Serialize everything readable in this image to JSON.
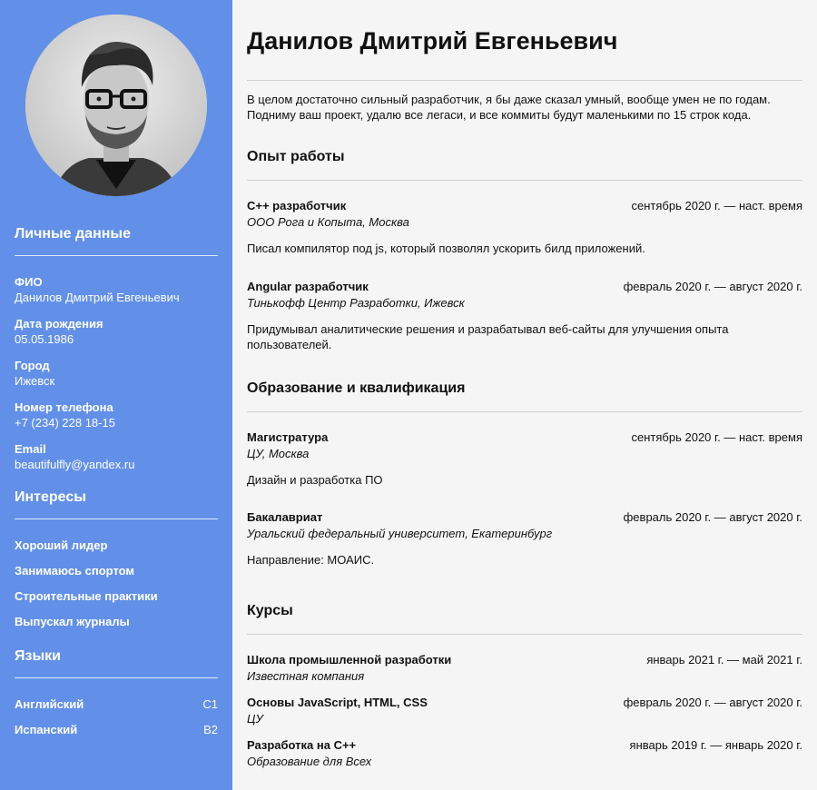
{
  "name": "Данилов Дмитрий Евгеньевич",
  "about": "В целом достаточно сильный разработчик, я бы даже сказал умный, вообще умен не по годам. Подниму ваш проект, удалю все легаси, и все коммиты будут маленькими по 15 строк кода.",
  "colors": {
    "sidebar": "#6290e8",
    "divider": "#d0d0d0"
  },
  "personal": {
    "heading": "Личные данные",
    "items": [
      {
        "label": "ФИО",
        "value": "Данилов Дмитрий Евгеньевич"
      },
      {
        "label": "Дата рождения",
        "value": "05.05.1986"
      },
      {
        "label": "Город",
        "value": "Ижевск"
      },
      {
        "label": "Номер телефона",
        "value": "+7 (234) 228 18-15"
      },
      {
        "label": "Email",
        "value": "beautifulfly@yandex.ru"
      }
    ]
  },
  "interests": {
    "heading": "Интересы",
    "items": [
      "Хороший лидер",
      "Занимаюсь спортом",
      "Строительные практики",
      "Выпускал журналы"
    ]
  },
  "languages": {
    "heading": "Языки",
    "items": [
      {
        "name": "Английский",
        "level": "C1"
      },
      {
        "name": "Испанский",
        "level": "B2"
      }
    ]
  },
  "experience": {
    "heading": "Опыт работы",
    "items": [
      {
        "title": "C++ разработчик",
        "dates": "сентябрь 2020 г. — наст. время",
        "org": "ООО Рога и Копыта, Москва",
        "desc": "Писал компилятор под js, который позволял ускорить билд приложений."
      },
      {
        "title": "Angular разработчик",
        "dates": "февраль 2020 г. — август 2020 г.",
        "org": "Тинькофф Центр Разработки, Ижевск",
        "desc": "Придумывал аналитические решения и разрабатывал веб-сайты для улучшения опыта пользователей."
      }
    ]
  },
  "education": {
    "heading": "Образование и квалификация",
    "items": [
      {
        "title": "Магистратура",
        "dates": "сентябрь 2020 г. — наст. время",
        "org": "ЦУ, Москва",
        "desc": "Дизайн и разработка ПО"
      },
      {
        "title": "Бакалавриат",
        "dates": "февраль 2020 г. — август 2020 г.",
        "org": "Уральский федеральный университет, Екатеринбург",
        "desc": "Направление: МОАИС."
      }
    ]
  },
  "courses": {
    "heading": "Курсы",
    "items": [
      {
        "title": "Школа промышленной разработки",
        "dates": "январь 2021 г. — май 2021 г.",
        "org": "Известная компания"
      },
      {
        "title": "Основы JavaScript, HTML, CSS",
        "dates": "февраль 2020 г. — август 2020 г.",
        "org": "ЦУ"
      },
      {
        "title": "Разработка на C++",
        "dates": "январь 2019 г. — январь 2020 г.",
        "org": "Образование для Всех"
      }
    ]
  }
}
